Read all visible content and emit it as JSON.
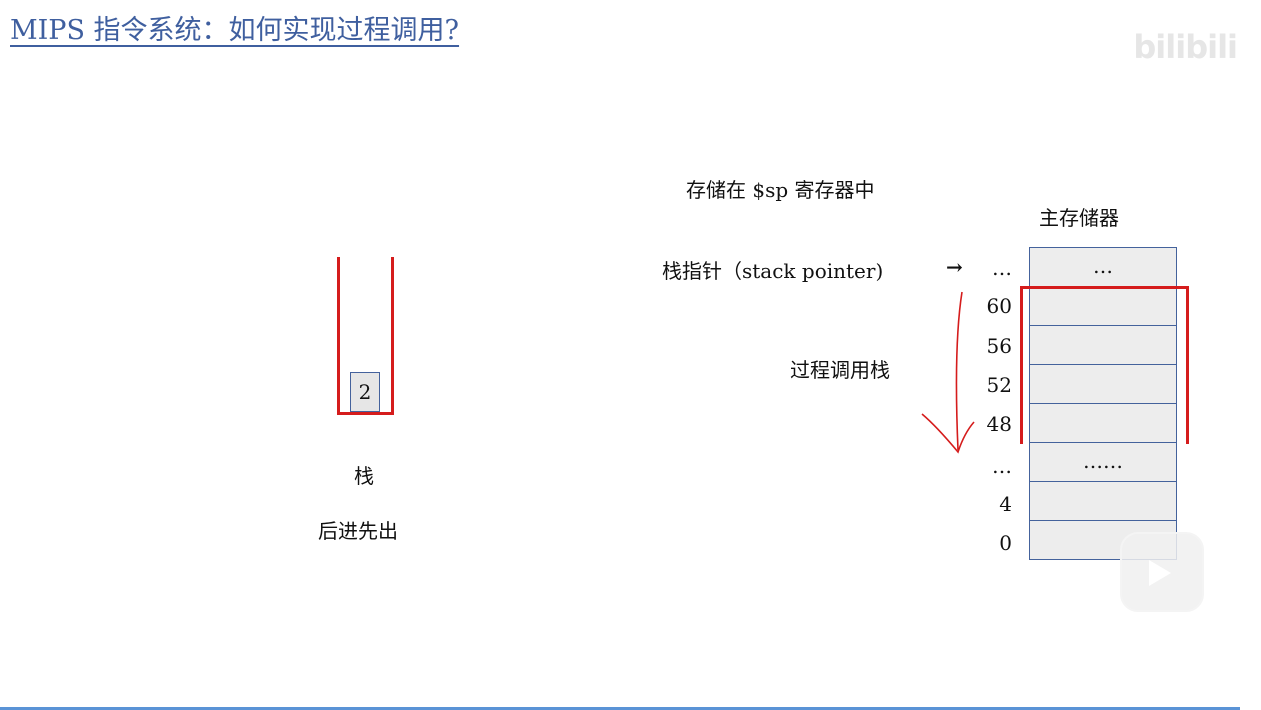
{
  "header": {
    "title": "MIPS 指令系统：如何实现过程调用?",
    "watermark": "bilibili"
  },
  "stack_figure": {
    "item_value": "2",
    "caption": "栈",
    "subcaption": "后进先出"
  },
  "memory_figure": {
    "sp_note": "存储在 $sp 寄存器中",
    "memory_title": "主存储器",
    "pointer_label": "栈指针（stack pointer)",
    "pointer_arrow": "→",
    "call_stack_label": "过程调用栈",
    "addresses": [
      "…",
      "60",
      "56",
      "52",
      "48",
      "…",
      "4",
      "0"
    ],
    "cells": [
      "…",
      "",
      "",
      "",
      "",
      "……",
      "",
      ""
    ],
    "colors": {
      "accent_red": "#d51c1c",
      "border_blue": "#44629c",
      "title_blue": "#3f5f9f"
    }
  }
}
